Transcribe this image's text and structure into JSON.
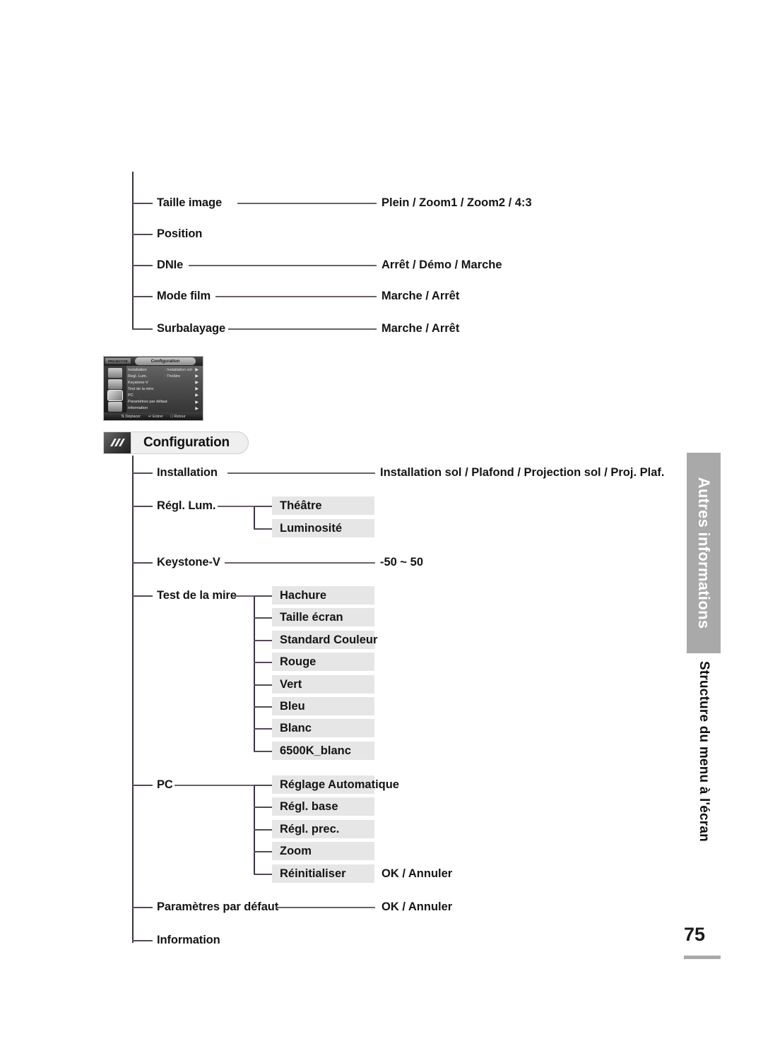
{
  "document": {
    "page_number": "75",
    "sidebar_tab": "Autres informations",
    "sidebar_subtitle": "Structure du menu à l'écran"
  },
  "top_tree": {
    "items": [
      {
        "label": "Taille image",
        "value": "Plein / Zoom1 / Zoom2 / 4:3",
        "has_rule": true
      },
      {
        "label": "Position",
        "value": "",
        "has_rule": false
      },
      {
        "label": "DNIe",
        "value": "Arrêt / Démo / Marche",
        "has_rule": true
      },
      {
        "label": "Mode film",
        "value": "Marche / Arrêt",
        "has_rule": true
      },
      {
        "label": "Surbalayage",
        "value": "Marche / Arrêt",
        "has_rule": true
      }
    ]
  },
  "osd": {
    "brand": "PROJECTOR",
    "title": "Configuration",
    "rows": [
      {
        "key": "Installation",
        "value": ": Installation sol",
        "arrow": "▶"
      },
      {
        "key": "Regl. Lum.",
        "value": ": Théâtre",
        "arrow": "▶"
      },
      {
        "key": "Keystone-V",
        "value": "",
        "arrow": "▶"
      },
      {
        "key": "Test de la mire",
        "value": "",
        "arrow": "▶"
      },
      {
        "key": "PC",
        "value": "",
        "arrow": "▶"
      },
      {
        "key": "Paramètres par défaut",
        "value": "",
        "arrow": "▶"
      },
      {
        "key": "Information",
        "value": "",
        "arrow": "▶"
      }
    ],
    "footer": [
      "⇅ Déplacer",
      "↵ Entrer",
      "□ Retour"
    ]
  },
  "section": {
    "icon": "settings-icon",
    "title": "Configuration"
  },
  "config_tree": {
    "items": [
      {
        "label": "Installation",
        "value": "Installation sol / Plafond / Projection sol / Proj. Plaf.",
        "children": []
      },
      {
        "label": "Régl. Lum.",
        "value": "",
        "children": [
          {
            "label": "Théâtre",
            "value": ""
          },
          {
            "label": "Luminosité",
            "value": ""
          }
        ]
      },
      {
        "label": "Keystone-V",
        "value": "-50 ~ 50",
        "children": []
      },
      {
        "label": "Test de la mire",
        "value": "",
        "children": [
          {
            "label": "Hachure",
            "value": ""
          },
          {
            "label": "Taille écran",
            "value": ""
          },
          {
            "label": "Standard Couleur",
            "value": ""
          },
          {
            "label": "Rouge",
            "value": ""
          },
          {
            "label": "Vert",
            "value": ""
          },
          {
            "label": "Bleu",
            "value": ""
          },
          {
            "label": "Blanc",
            "value": ""
          },
          {
            "label": "6500K_blanc",
            "value": ""
          }
        ]
      },
      {
        "label": "PC",
        "value": "",
        "children": [
          {
            "label": "Réglage Automatique",
            "value": ""
          },
          {
            "label": "Régl. base",
            "value": ""
          },
          {
            "label": "Régl. prec.",
            "value": ""
          },
          {
            "label": "Zoom",
            "value": ""
          },
          {
            "label": "Réinitialiser",
            "value": "OK / Annuler"
          }
        ]
      },
      {
        "label": "Paramètres par défaut",
        "value": "OK / Annuler",
        "children": []
      },
      {
        "label": "Information",
        "value": "",
        "children": []
      }
    ]
  },
  "colors": {
    "chip_bg": "#e6e6e6",
    "sidebar_gray": "#a9a9a9",
    "rule": "#544a56",
    "text": "#141414"
  }
}
